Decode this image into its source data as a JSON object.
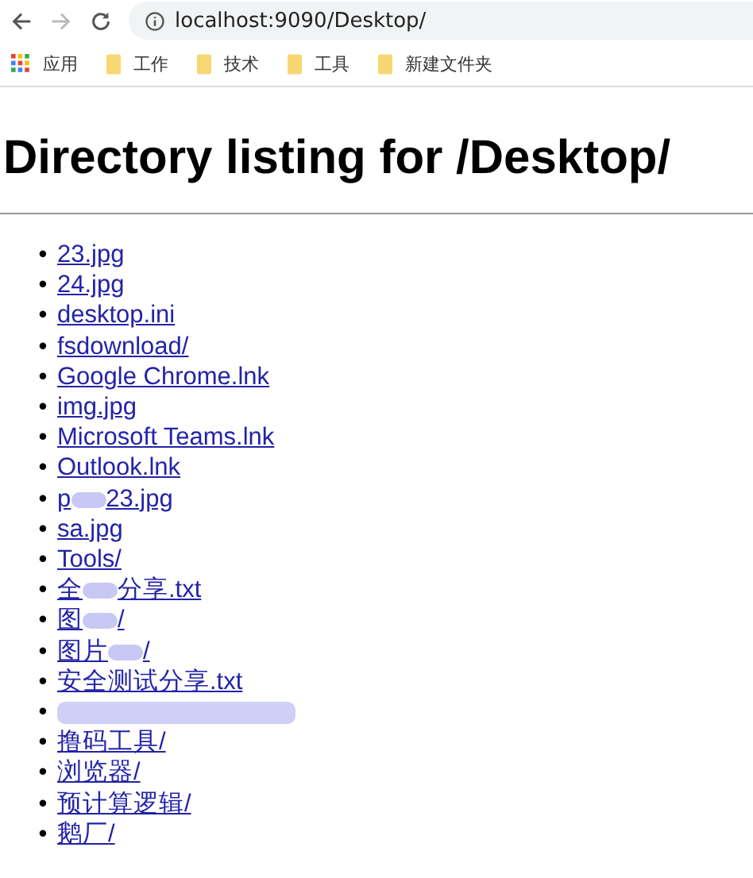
{
  "toolbar": {
    "address": "localhost:9090/Desktop/"
  },
  "bookmarks": [
    {
      "kind": "apps",
      "label": "应用"
    },
    {
      "kind": "folder",
      "label": "工作"
    },
    {
      "kind": "folder",
      "label": "技术"
    },
    {
      "kind": "folder",
      "label": "工具"
    },
    {
      "kind": "folder",
      "label": "新建文件夹"
    }
  ],
  "heading": "Directory listing for /Desktop/",
  "entries": [
    {
      "bullet": "•",
      "kind": "link",
      "parts": [
        "23.jpg"
      ]
    },
    {
      "bullet": "•",
      "kind": "link",
      "parts": [
        "24.jpg"
      ]
    },
    {
      "bullet": "•",
      "kind": "link",
      "parts": [
        "desktop.ini"
      ]
    },
    {
      "bullet": "•",
      "kind": "link",
      "parts": [
        "fsdownload/"
      ]
    },
    {
      "bullet": "•",
      "kind": "link",
      "parts": [
        "Google Chrome.lnk"
      ]
    },
    {
      "bullet": "•",
      "kind": "link",
      "parts": [
        "img.jpg"
      ]
    },
    {
      "bullet": "•",
      "kind": "link",
      "parts": [
        "Microsoft Teams.lnk"
      ]
    },
    {
      "bullet": "•",
      "kind": "link",
      "parts": [
        "Outlook.lnk"
      ]
    },
    {
      "bullet": "•",
      "kind": "link",
      "parts": [
        "p",
        "23.jpg"
      ]
    },
    {
      "bullet": "•",
      "kind": "link",
      "parts": [
        "sa.jpg"
      ]
    },
    {
      "bullet": "•",
      "kind": "link",
      "parts": [
        "Tools/"
      ]
    },
    {
      "bullet": "•",
      "kind": "link",
      "parts": [
        "全",
        "分享.txt"
      ]
    },
    {
      "bullet": "•",
      "kind": "link",
      "parts": [
        "图",
        "/"
      ]
    },
    {
      "bullet": "•",
      "kind": "link",
      "parts": [
        "图片",
        "/"
      ]
    },
    {
      "bullet": "•",
      "kind": "link",
      "parts": [
        "安全测试分享.txt"
      ]
    },
    {
      "bullet": "•",
      "kind": "redacted"
    },
    {
      "bullet": "•",
      "kind": "link",
      "parts": [
        "撸码工具/"
      ]
    },
    {
      "bullet": "•",
      "kind": "link",
      "parts": [
        "浏览器/"
      ]
    },
    {
      "bullet": "•",
      "kind": "link",
      "parts": [
        "预计算逻辑/"
      ]
    },
    {
      "bullet": "•",
      "kind": "link",
      "parts": [
        "鹅厂/"
      ]
    }
  ]
}
